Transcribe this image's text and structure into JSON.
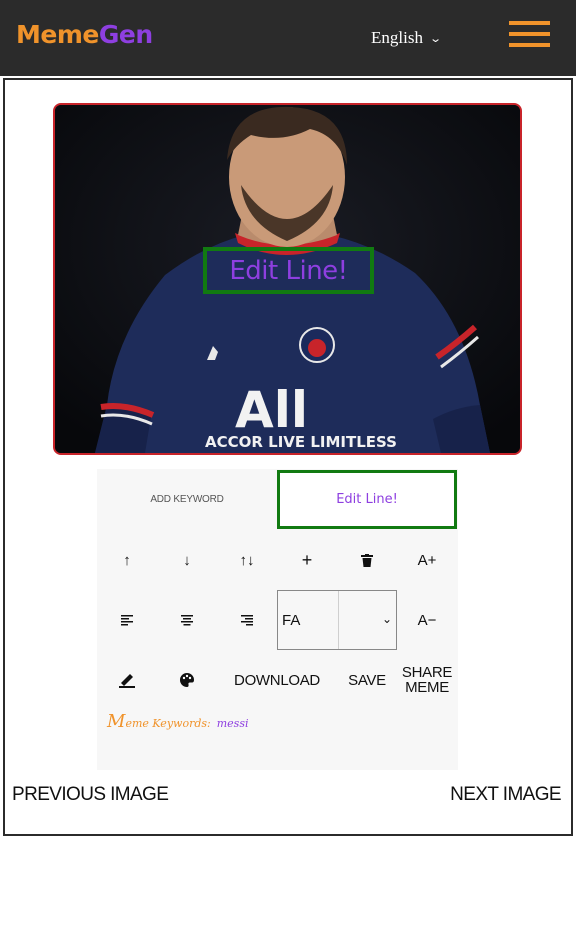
{
  "header": {
    "logo_part1": "Meme",
    "logo_part2": "Gen",
    "language": "English",
    "colors": {
      "background": "#2b2b2b",
      "orange": "#f0932b",
      "purple": "#8e3fe0"
    }
  },
  "canvas": {
    "line_text": "Edit Line!",
    "colors": {
      "border": "#c8242a",
      "text_box_border": "#117a11"
    }
  },
  "editor": {
    "add_keyword_label": "ADD KEYWORD",
    "line_input_value": "Edit Line!",
    "controls": {
      "move_up": "↑",
      "move_down": "↓",
      "switch_lines": "↑↓",
      "add_line": "+",
      "delete_icon": "trash-icon",
      "increase_font": "A+",
      "align_left_icon": "align-left-icon",
      "align_center_icon": "align-center-icon",
      "align_right_icon": "align-right-icon",
      "font_value": "FA",
      "decrease_font": "A−",
      "stroke_color_icon": "brush-icon",
      "fill_color_icon": "palette-icon",
      "download": "DOWNLOAD",
      "save": "SAVE",
      "share_line1": "SHARE",
      "share_line2": "MEME"
    },
    "keywords_title_first": "M",
    "keywords_title_rest": "eme Keywords:",
    "keywords_value": "messi"
  },
  "navigation": {
    "previous": "PREVIOUS IMAGE",
    "next": "NEXT IMAGE"
  }
}
